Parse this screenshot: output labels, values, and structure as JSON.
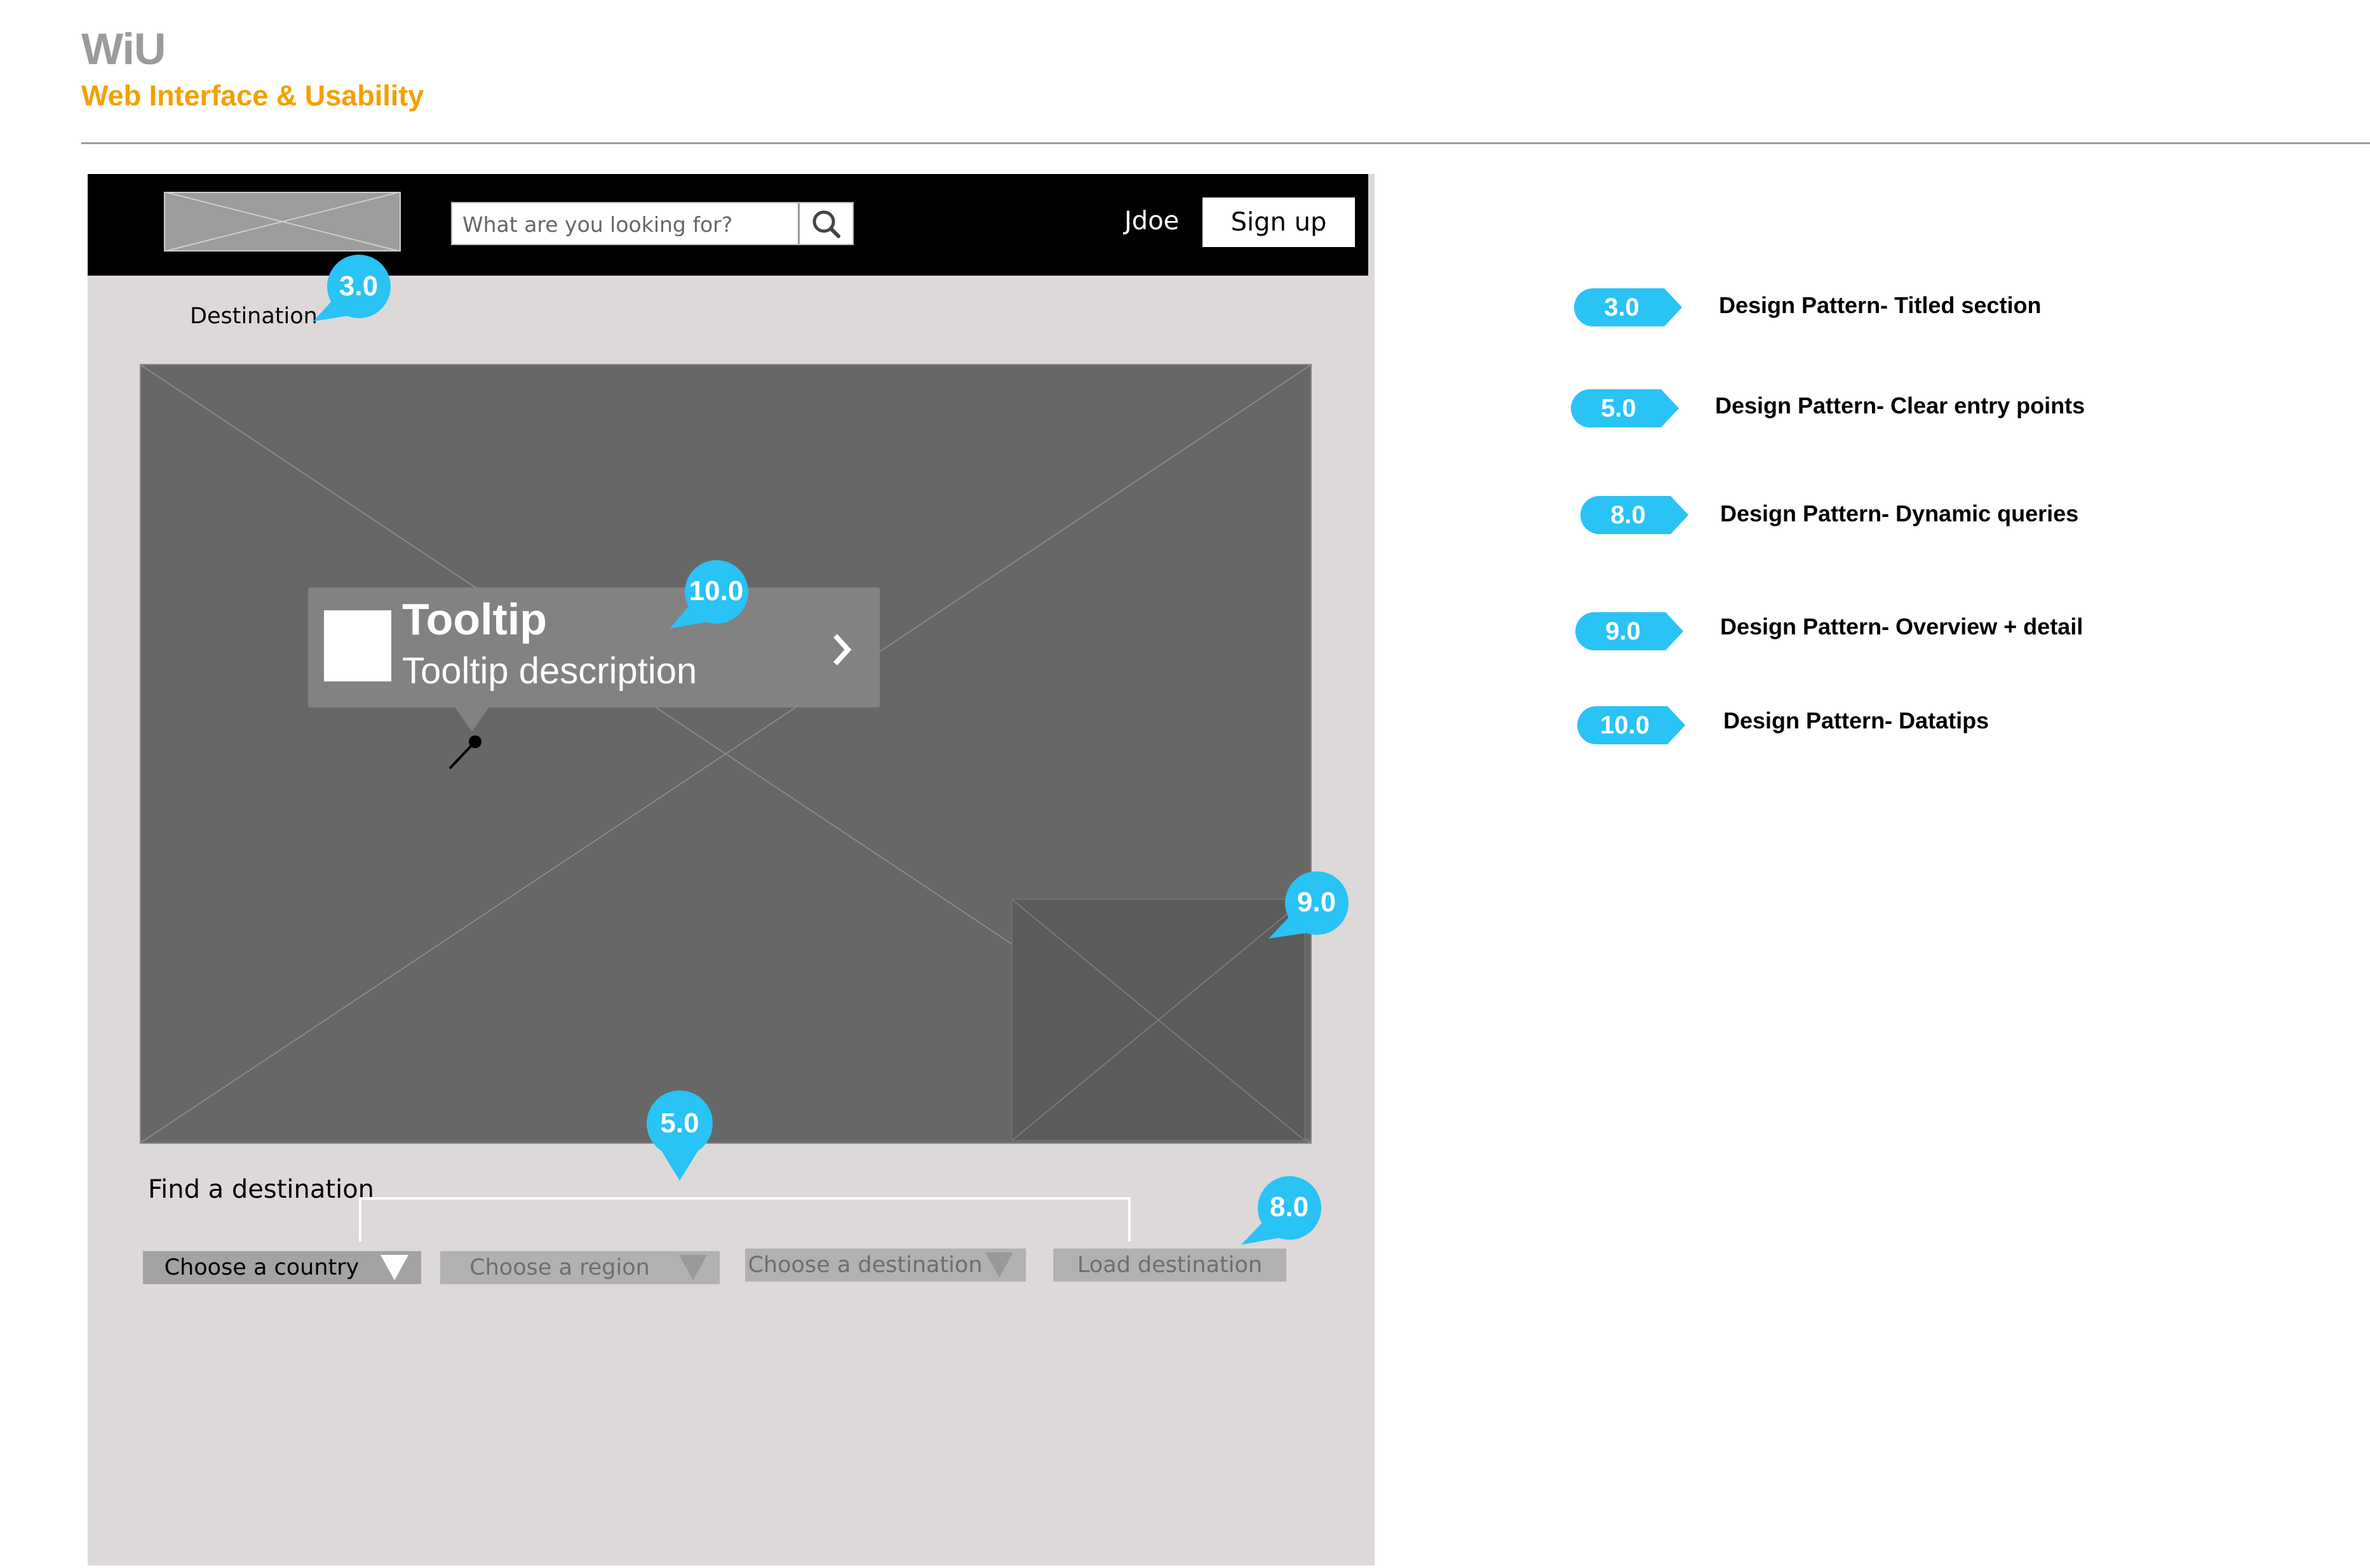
{
  "header": {
    "title": "WiU",
    "subtitle": "Web Interface & Usability"
  },
  "navbar": {
    "search_placeholder": "What are you looking for?",
    "username": "Jdoe",
    "signup_label": "Sign up"
  },
  "section": {
    "destination_label": "Destination"
  },
  "tooltip": {
    "title": "Tooltip",
    "description": "Tooltip description"
  },
  "finder": {
    "label": "Find a destination",
    "country": "Choose a country",
    "region": "Choose a region",
    "destination": "Choose a destination",
    "load": "Load destination"
  },
  "markers": {
    "titled_section": "3.0",
    "datatips": "10.0",
    "overview_detail": "9.0",
    "entry_points": "5.0",
    "dynamic_queries": "8.0"
  },
  "legend": [
    {
      "badge": "3.0",
      "text": "Design Pattern- Titled section"
    },
    {
      "badge": "5.0",
      "text": "Design Pattern- Clear entry points"
    },
    {
      "badge": "8.0",
      "text": "Design Pattern- Dynamic queries"
    },
    {
      "badge": "9.0",
      "text": "Design Pattern- Overview + detail"
    },
    {
      "badge": "10.0",
      "text": "Design Pattern- Datatips"
    }
  ],
  "colors": {
    "accent": "#29c3f5",
    "brand_orange": "#f2a000",
    "navbar": "#000000",
    "panel": "#dcd9d8"
  }
}
